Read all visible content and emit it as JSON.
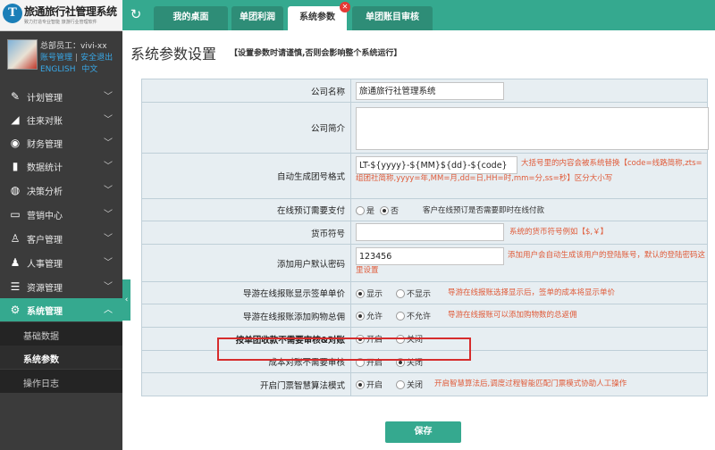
{
  "logo": {
    "mark": "T",
    "title": "旅通旅行社管理系统",
    "subtitle": "致力打造专业智能 旅游行业管理软件"
  },
  "user": {
    "line": "总部员工：vivi-xx",
    "account_link": "账号管理",
    "logout_link": "安全退出",
    "lang_en": "ENGLISH",
    "lang_cn": "中文"
  },
  "nav": {
    "items": [
      {
        "label": "计划管理",
        "icon": "pencil-icon"
      },
      {
        "label": "往来对账",
        "icon": "bag-icon"
      },
      {
        "label": "财务管理",
        "icon": "coins-icon"
      },
      {
        "label": "数据统计",
        "icon": "bar-chart-icon"
      },
      {
        "label": "决策分析",
        "icon": "globe-icon"
      },
      {
        "label": "营销中心",
        "icon": "monitor-icon"
      },
      {
        "label": "客户管理",
        "icon": "user-plus-icon"
      },
      {
        "label": "人事管理",
        "icon": "user-icon"
      },
      {
        "label": "资源管理",
        "icon": "list-icon"
      },
      {
        "label": "系统管理",
        "icon": "gear-icon"
      }
    ],
    "sub_items": [
      {
        "label": "基础数据"
      },
      {
        "label": "系统参数"
      },
      {
        "label": "操作日志"
      }
    ]
  },
  "tabs": [
    {
      "label": "我的桌面"
    },
    {
      "label": "单团利润"
    },
    {
      "label": "系统参数"
    },
    {
      "label": "单团账目审核"
    }
  ],
  "page": {
    "title": "系统参数设置",
    "note": "【设置参数时请谨慎,否则会影响整个系统运行】"
  },
  "form": {
    "company_name": {
      "label": "公司名称",
      "value": "旅通旅行社管理系统"
    },
    "company_intro": {
      "label": "公司简介",
      "value": ""
    },
    "group_no_format": {
      "label": "自动生成团号格式",
      "value": "LT-${yyyy}-${MM}${dd}-${code}",
      "hint": "大括号里的内容会被系统替换【code=线路简称,zts=组团社简称,yyyy=年,MM=月,dd=日,HH=时,mm=分,ss=秒】区分大小写"
    },
    "online_pay": {
      "label": "在线预订需要支付",
      "opt_yes": "是",
      "opt_no": "否",
      "selected": "否",
      "hint": "客户在线预订是否需要即时在线付款"
    },
    "currency": {
      "label": "货币符号",
      "value": "",
      "hint": "系统的货币符号例如【$,￥】"
    },
    "default_password": {
      "label": "添加用户默认密码",
      "value": "123456",
      "hint": "添加用户会自动生成该用户的登陆账号，默认的登陆密码这里设置"
    },
    "guide_price": {
      "label": "导游在线报账显示签单单价",
      "opt_a": "显示",
      "opt_b": "不显示",
      "selected": "显示",
      "hint": "导游在线报账选择显示后，签单的成本将显示单价"
    },
    "guide_shopping": {
      "label": "导游在线报账添加购物总佣",
      "opt_a": "允许",
      "opt_b": "不允许",
      "selected": "允许",
      "hint": "导游在线报账可以添加购物数的总返佣"
    },
    "single_group_receipt": {
      "label": "按单团收款不需要审核&对账",
      "opt_a": "开启",
      "opt_b": "关闭",
      "selected": "开启"
    },
    "cost_reconcile": {
      "label": "成本对账不需要审核",
      "opt_a": "开启",
      "opt_b": "关闭",
      "selected": "关闭"
    },
    "smart_ticket": {
      "label": "开启门票智慧算法模式",
      "opt_a": "开启",
      "opt_b": "关闭",
      "selected": "开启",
      "hint": "开启智慧算法后,调度过程智能匹配门票模式协助人工操作"
    }
  },
  "save_label": "保存",
  "colors": {
    "accent": "#35a98f",
    "sidebar": "#3b3b3b",
    "hint": "#e05a38",
    "highlight": "#d62c2c"
  }
}
